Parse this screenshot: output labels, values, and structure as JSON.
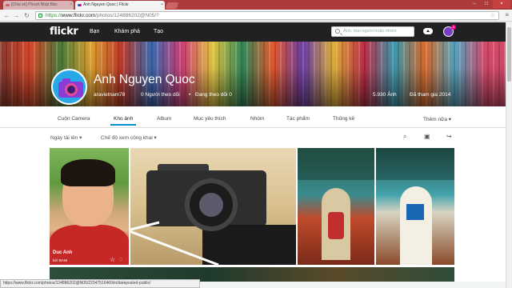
{
  "browser": {
    "tabs": [
      {
        "label": "[Chia sẻ] Phượt Nhật Bản"
      },
      {
        "label": "Anh Nguyen Quoc | Flickr"
      }
    ],
    "url_https": "https://",
    "url_host": "www.flickr.com",
    "url_path": "/photos/124886202@N05/?",
    "status_url": "https://www.flickr.com/photos/124886202@N05/22347516460/in/dateposted-public/"
  },
  "flickr": {
    "logo": "flickr",
    "nav": [
      "Bạn",
      "Khám phá",
      "Tạo"
    ],
    "search_placeholder": "Ảnh, mọi người hoặc nhóm",
    "notif_count": "1"
  },
  "profile": {
    "name": "Anh Nguyen Quoc",
    "username": "aravietnam78",
    "followers": "0 Người theo dõi",
    "following": "Đang theo dõi 0",
    "photo_count": "5.930 Ảnh",
    "joined": "Đã tham gia 2014"
  },
  "subnav": {
    "items": [
      "Cuộn Camera",
      "Kho ảnh",
      "Album",
      "Mục yêu thích",
      "Nhóm",
      "Tác phẩm",
      "Thống kê"
    ],
    "active": "Kho ảnh",
    "more": "Thêm nữa ▾"
  },
  "toolbar": {
    "sort": "Ngày tải lên ▾",
    "mode": "Chế độ xem công khai ▾"
  },
  "photos": [
    {
      "title": "Duc Anh",
      "owner": "bởi BANI"
    }
  ],
  "colors": {
    "accent": "#008ecf",
    "brand_pink": "#ff0084",
    "brand_blue": "#0063dc"
  }
}
